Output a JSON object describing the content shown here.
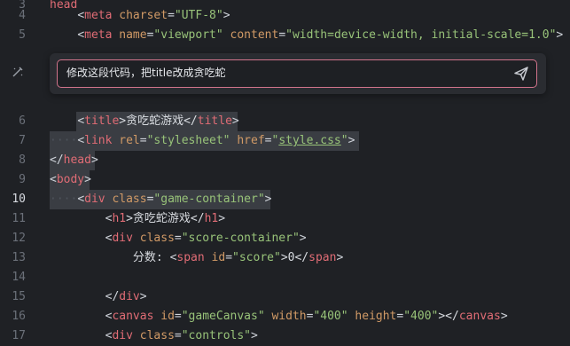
{
  "editor": {
    "lines": [
      {
        "num": "3",
        "text": "head"
      },
      {
        "num": "4",
        "indent": "    ",
        "open": "<",
        "tag": "meta",
        "a1": "charset",
        "v1": "\"UTF-8\"",
        "close": ">"
      },
      {
        "num": "5",
        "indent": "    ",
        "open": "<",
        "tag": "meta",
        "a1": "name",
        "v1": "\"viewport\"",
        "a2": "content",
        "v2": "\"width=device-width, initial-scale=1.0\"",
        "close": ">"
      },
      {
        "num": "6",
        "indent": "    ",
        "open": "<",
        "tag": "title",
        "mid": ">贪吃蛇游戏</",
        "tag2": "title",
        "close": ">"
      },
      {
        "num": "7",
        "indent": "····",
        "open": "<",
        "tag": "link",
        "a1": "rel",
        "v1": "\"stylesheet\"",
        "a2": "href",
        "v2q1": "\"",
        "v2link": "style.css",
        "v2q2": "\"",
        "close": ">"
      },
      {
        "num": "8",
        "open": "</",
        "tag": "head",
        "close": ">"
      },
      {
        "num": "9",
        "open": "<",
        "tag": "body",
        "close": ">"
      },
      {
        "num": "10",
        "indent": "····",
        "open": "<",
        "tag": "div",
        "a1": "class",
        "v1": "\"game-container\"",
        "close": ">"
      },
      {
        "num": "11",
        "indent": "        ",
        "open": "<",
        "tag": "h1",
        "mid": ">贪吃蛇游戏</",
        "tag2": "h1",
        "close": ">"
      },
      {
        "num": "12",
        "indent": "        ",
        "open": "<",
        "tag": "div",
        "a1": "class",
        "v1": "\"score-container\"",
        "close": ">"
      },
      {
        "num": "13",
        "indent": "            ",
        "pre": "分数: ",
        "open": "<",
        "tag": "span",
        "a1": "id",
        "v1": "\"score\"",
        "mid": ">0</",
        "tag2": "span",
        "close": ">"
      },
      {
        "num": "14"
      },
      {
        "num": "15",
        "indent": "        ",
        "open": "</",
        "tag": "div",
        "close": ">"
      },
      {
        "num": "16",
        "indent": "        ",
        "open": "<",
        "tag": "canvas",
        "a1": "id",
        "v1": "\"gameCanvas\"",
        "a2": "width",
        "v2": "\"400\"",
        "a3": "height",
        "v3": "\"400\"",
        "mid": "></",
        "tag2": "canvas",
        "close": ">"
      },
      {
        "num": "17",
        "indent": "        ",
        "open": "<",
        "tag": "div",
        "a1": "class",
        "v1": "\"controls\"",
        "close": ">"
      }
    ],
    "active_line": "10"
  },
  "inline_edit": {
    "prompt": "修改这段代码，把title改成贪吃蛇",
    "wand_icon": "magic-wand-icon",
    "send_icon": "send-icon"
  },
  "colors": {
    "background": "#1f2125",
    "tag": "#e06c75",
    "attr": "#d19a66",
    "string": "#98c379",
    "prompt_border": "#d2748c"
  }
}
